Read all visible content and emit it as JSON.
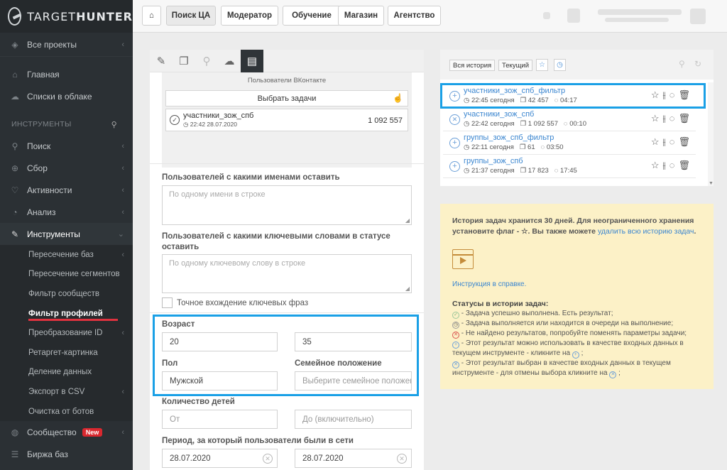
{
  "brand": {
    "name_light": "TARGET",
    "name_bold": "HUNTER"
  },
  "sidebar": {
    "all_projects": "Все проекты",
    "home": "Главная",
    "cloud_lists": "Списки в облаке",
    "section_tools": "ИНСТРУМЕНТЫ",
    "items": [
      "Поиск",
      "Сбор",
      "Активности",
      "Анализ",
      "Инструменты"
    ],
    "sub_items": [
      "Пересечение баз",
      "Пересечение сегментов",
      "Фильтр сообществ",
      "Фильтр профилей",
      "Преобразование ID",
      "Ретаргет-картинка",
      "Деление данных",
      "Экспорт в CSV",
      "Очистка от ботов"
    ],
    "community": "Сообщество",
    "new_badge": "New",
    "exchange": "Биржа баз"
  },
  "topnav": [
    "Поиск ЦА",
    "Модератор",
    "Обучение",
    "Магазин",
    "Агентство"
  ],
  "left": {
    "vk_title": "Пользователи ВКонтакте",
    "choose_tasks": "Выбрать задачи",
    "selected_task": {
      "name": "участники_зож_спб",
      "date": "22:42 28.07.2020",
      "count": "1 092 557"
    },
    "names_label": "Пользователей с какими именами оставить",
    "names_placeholder": "По одному имени в строке",
    "keywords_label": "Пользователей с какими ключевыми словами в статусе оставить",
    "keywords_placeholder": "По одному ключевому слову в строке",
    "exact_label": "Точное вхождение ключевых фраз",
    "age_label": "Возраст",
    "age_from": "20",
    "age_to": "35",
    "sex_label": "Пол",
    "sex_value": "Мужской",
    "family_label": "Семейное положение",
    "family_placeholder": "Выберите семейное положение",
    "children_label": "Количество детей",
    "children_from": "От",
    "children_to": "До (включительно)",
    "period_label": "Период, за который пользователи были в сети",
    "period_from": "28.07.2020",
    "period_to": "28.07.2020"
  },
  "history": {
    "all": "Вся история",
    "current": "Текущий",
    "rows": [
      {
        "name": "участники_зож_спб_фильтр",
        "time": "22:45 сегодня",
        "count": "42 457",
        "duration": "04:17",
        "status": "plus"
      },
      {
        "name": "участники_зож_спб",
        "time": "22:42 сегодня",
        "count": "1 092 557",
        "duration": "00:10",
        "status": "cross"
      },
      {
        "name": "группы_зож_спб_фильтр",
        "time": "22:11 сегодня",
        "count": "61",
        "duration": "03:50",
        "status": "plus"
      },
      {
        "name": "группы_зож_спб",
        "time": "21:37 сегодня",
        "count": "17 823",
        "duration": "17:45",
        "status": "plus"
      }
    ]
  },
  "info": {
    "text1": "История задач хранится 30 дней. Для неограниченного хранения установите флаг - ☆. Вы также можете",
    "delete_link": "удалить всю историю задач",
    "instruction": "Инструкция в справке.",
    "statuses_title": "Статусы в истории задач:",
    "s1": "- Задача успешно выполнена. Есть результат;",
    "s2": "- Задача выполняется или находится в очереди на выполнение;",
    "s3": "- Не найдено результатов, попробуйте поменять параметры задачи;",
    "s4": "- Этот результат можно использовать в качестве входных данных в текущем инструменте - кликните на",
    "s5": "- Этот результат выбран в качестве входных данных в текущем инструменте - для отмены выбора кликните на"
  },
  "colors": {
    "sidebar_bg": "#2b3034",
    "highlight": "#1aa0e6",
    "link": "#3b86d0",
    "info_bg": "#fcf1c7",
    "accent_red": "#e0323f"
  }
}
